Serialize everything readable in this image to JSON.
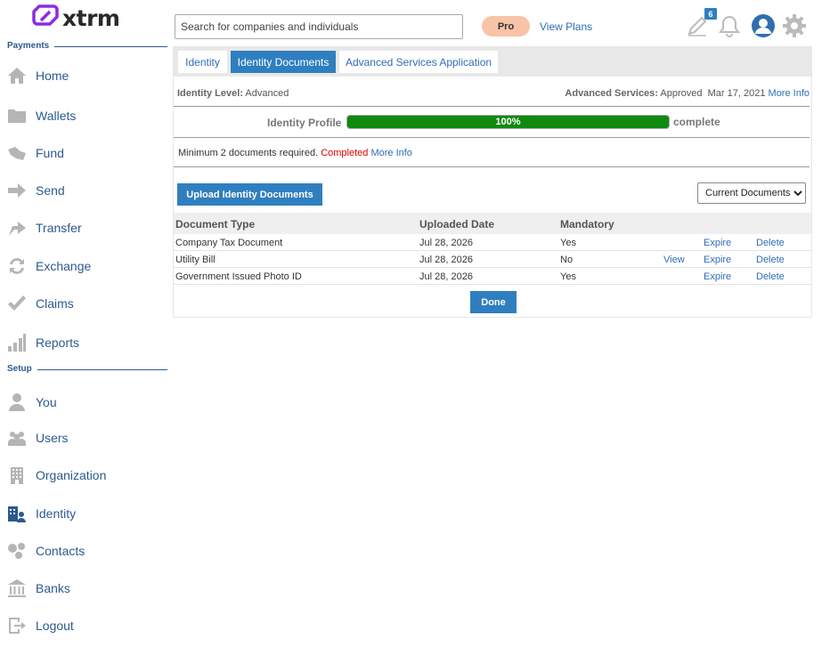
{
  "app": {
    "logo_text": "xtrm",
    "brand_color": "#8b2be2"
  },
  "sidebar": {
    "sections": [
      {
        "label": "Payments"
      },
      {
        "label": "Setup"
      }
    ],
    "items": [
      {
        "label": "Home",
        "icon": "home-icon"
      },
      {
        "label": "Wallets",
        "icon": "folder-icon"
      },
      {
        "label": "Fund",
        "icon": "fund-icon"
      },
      {
        "label": "Send",
        "icon": "arrow-right-icon"
      },
      {
        "label": "Transfer",
        "icon": "transfer-icon"
      },
      {
        "label": "Exchange",
        "icon": "exchange-icon"
      },
      {
        "label": "Claims",
        "icon": "checkmark-icon"
      },
      {
        "label": "Reports",
        "icon": "bar-chart-icon"
      },
      {
        "label": "You",
        "icon": "person-icon"
      },
      {
        "label": "Users",
        "icon": "users-icon"
      },
      {
        "label": "Organization",
        "icon": "building-icon"
      },
      {
        "label": "Identity",
        "icon": "identity-icon"
      },
      {
        "label": "Contacts",
        "icon": "contacts-icon"
      },
      {
        "label": "Banks",
        "icon": "bank-icon"
      },
      {
        "label": "Logout",
        "icon": "logout-icon"
      }
    ]
  },
  "header": {
    "search_placeholder": "Search for companies and individuals",
    "plan_badge": "Pro",
    "view_plans": "View Plans",
    "notification_count": "6",
    "icons": [
      "edit-icon",
      "bell-icon",
      "user-avatar-icon",
      "gear-icon"
    ]
  },
  "tabs": [
    {
      "label": "Identity",
      "active": false
    },
    {
      "label": "Identity Documents",
      "active": true
    },
    {
      "label": "Advanced Services Application",
      "active": false
    }
  ],
  "identity": {
    "level_label": "Identity Level:",
    "level_value": "Advanced",
    "advanced_label": "Advanced Services:",
    "advanced_value": "Approved",
    "advanced_date": "Mar 17, 2021",
    "more_info": "More Info",
    "profile_label": "Identity Profile",
    "profile_percent": 100,
    "profile_percent_text": "100%",
    "complete_label": "complete",
    "min_docs_text": "Minimum 2 documents required.",
    "min_docs_status": "Completed",
    "min_docs_more": "More Info"
  },
  "actions": {
    "upload_label": "Upload Identity Documents",
    "filter_selected": "Current Documents",
    "done_label": "Done"
  },
  "table": {
    "headers": [
      "Document Type",
      "Uploaded Date",
      "Mandatory"
    ],
    "rows": [
      {
        "type": "Company Tax Document",
        "date": "Jul 28, 2026",
        "mandatory": "Yes",
        "view": "",
        "expire": "Expire",
        "delete": "Delete"
      },
      {
        "type": "Utility Bill",
        "date": "Jul 28, 2026",
        "mandatory": "No",
        "view": "View",
        "expire": "Expire",
        "delete": "Delete"
      },
      {
        "type": "Government Issued Photo ID",
        "date": "Jul 28, 2026",
        "mandatory": "Yes",
        "view": "",
        "expire": "Expire",
        "delete": "Delete"
      }
    ]
  },
  "colors": {
    "accent": "#2f7fc0",
    "progress": "#0f8a0f",
    "pro_pill": "#f9c3a8",
    "sidebar_text": "#2c5a8f"
  }
}
